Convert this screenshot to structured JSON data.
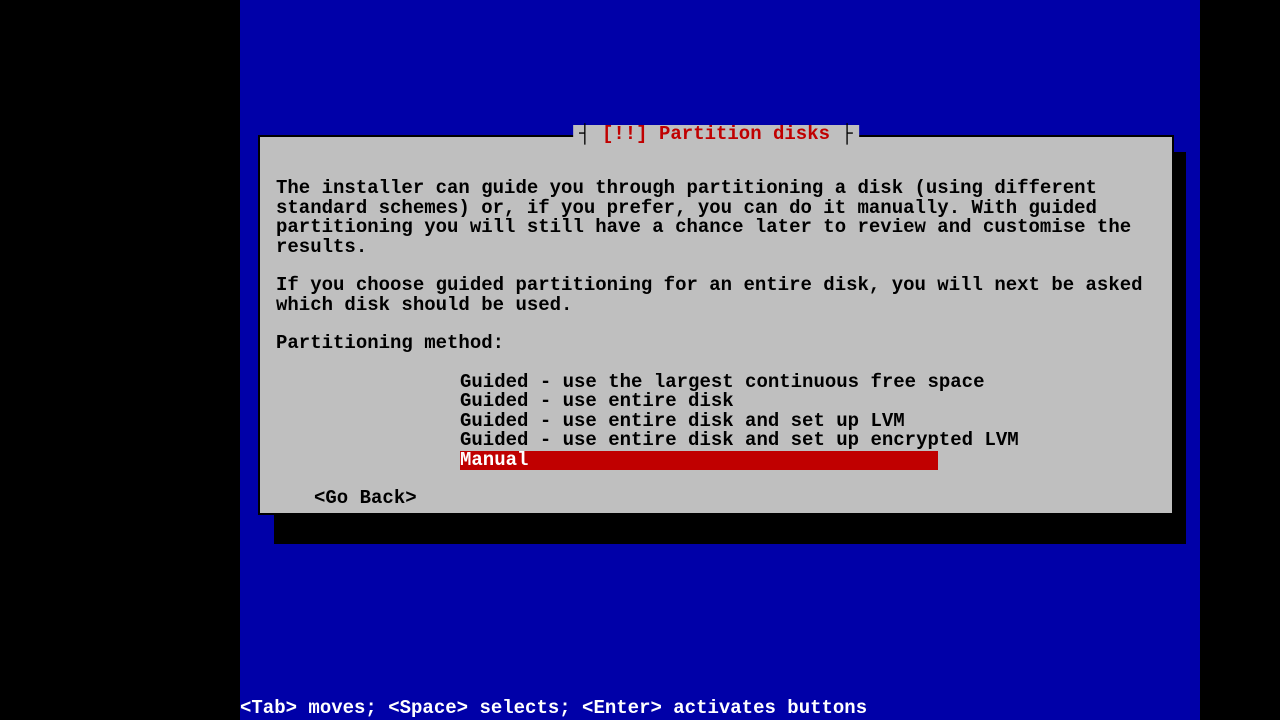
{
  "dialog": {
    "title_open": "┤ ",
    "title_bangs": "[!!]",
    "title_text": " Partition disks",
    "title_close": " ├",
    "para1": "The installer can guide you through partitioning a disk (using different standard schemes) or, if you prefer, you can do it manually. With guided partitioning you will still have a chance later to review and customise the results.",
    "para2": "If you choose guided partitioning for an entire disk, you will next be asked which disk should be used.",
    "prompt": "Partitioning method:",
    "options": {
      "0": "Guided - use the largest continuous free space",
      "1": "Guided - use entire disk",
      "2": "Guided - use entire disk and set up LVM",
      "3": "Guided - use entire disk and set up encrypted LVM",
      "4": "Manual"
    },
    "go_back": "<Go Back>"
  },
  "hint": "<Tab> moves; <Space> selects; <Enter> activates buttons"
}
